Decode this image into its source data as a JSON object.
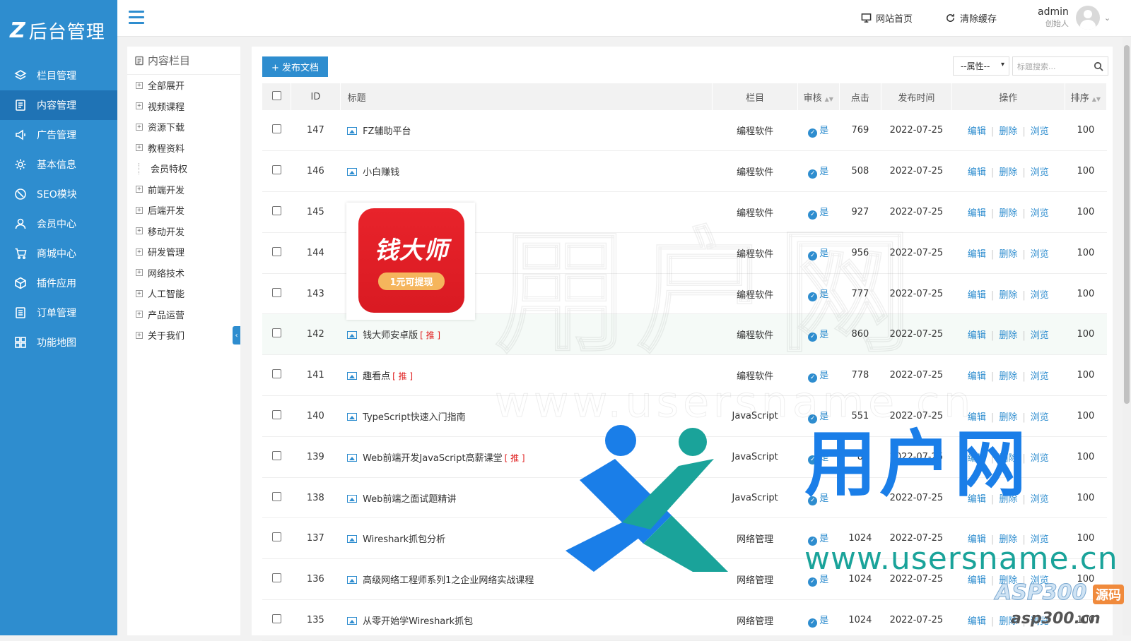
{
  "app": {
    "logo_mark": "Z",
    "logo_text": "后台管理"
  },
  "sidebar": {
    "items": [
      {
        "label": "栏目管理",
        "icon": "layers-icon",
        "active": false
      },
      {
        "label": "内容管理",
        "icon": "document-icon",
        "active": true
      },
      {
        "label": "广告管理",
        "icon": "megaphone-icon",
        "active": false
      },
      {
        "label": "基本信息",
        "icon": "gear-icon",
        "active": false
      },
      {
        "label": "SEO模块",
        "icon": "seo-icon",
        "active": false
      },
      {
        "label": "会员中心",
        "icon": "user-icon",
        "active": false
      },
      {
        "label": "商城中心",
        "icon": "cart-icon",
        "active": false
      },
      {
        "label": "插件应用",
        "icon": "cube-icon",
        "active": false
      },
      {
        "label": "订单管理",
        "icon": "order-icon",
        "active": false
      },
      {
        "label": "功能地图",
        "icon": "grid-icon",
        "active": false
      }
    ]
  },
  "header": {
    "site_home": "网站首页",
    "clear_cache": "清除缓存",
    "username": "admin",
    "role": "创始人"
  },
  "tree": {
    "title": "内容栏目",
    "items": [
      {
        "label": "全部展开",
        "expandable": true
      },
      {
        "label": "视频课程",
        "expandable": true
      },
      {
        "label": "资源下载",
        "expandable": true
      },
      {
        "label": "教程资料",
        "expandable": true
      },
      {
        "label": "会员特权",
        "expandable": false
      },
      {
        "label": "前端开发",
        "expandable": true
      },
      {
        "label": "后端开发",
        "expandable": true
      },
      {
        "label": "移动开发",
        "expandable": true
      },
      {
        "label": "研发管理",
        "expandable": true
      },
      {
        "label": "网络技术",
        "expandable": true
      },
      {
        "label": "人工智能",
        "expandable": true
      },
      {
        "label": "产品运营",
        "expandable": true
      },
      {
        "label": "关于我们",
        "expandable": true
      }
    ]
  },
  "toolbar": {
    "publish_label": "+ 发布文档",
    "attr_select": "--属性--",
    "search_placeholder": "标题搜索..."
  },
  "table": {
    "headers": {
      "id": "ID",
      "title": "标题",
      "column": "栏目",
      "audit": "审核",
      "clicks": "点击",
      "time": "发布时间",
      "ops": "操作",
      "sort": "排序"
    },
    "actions": {
      "edit": "编辑",
      "delete": "删除",
      "view": "浏览"
    },
    "rec_tag": "[ 推 ]",
    "rows": [
      {
        "id": "147",
        "title": "FZ辅助平台",
        "rec": false,
        "column": "编程软件",
        "audit": "是",
        "clicks": "769",
        "time": "2022-07-25",
        "sort": "100"
      },
      {
        "id": "146",
        "title": "小白赚钱",
        "rec": false,
        "column": "编程软件",
        "audit": "是",
        "clicks": "508",
        "time": "2022-07-25",
        "sort": "100"
      },
      {
        "id": "145",
        "title": "",
        "rec": false,
        "column": "编程软件",
        "audit": "是",
        "clicks": "927",
        "time": "2022-07-25",
        "sort": "100"
      },
      {
        "id": "144",
        "title": "",
        "rec": false,
        "column": "编程软件",
        "audit": "是",
        "clicks": "956",
        "time": "2022-07-25",
        "sort": "100"
      },
      {
        "id": "143",
        "title": "",
        "rec": false,
        "column": "编程软件",
        "audit": "是",
        "clicks": "777",
        "time": "2022-07-25",
        "sort": "100"
      },
      {
        "id": "142",
        "title": "钱大师安卓版",
        "rec": true,
        "column": "编程软件",
        "audit": "是",
        "clicks": "860",
        "time": "2022-07-25",
        "sort": "100",
        "highlight": true
      },
      {
        "id": "141",
        "title": "趣看点",
        "rec": true,
        "column": "编程软件",
        "audit": "是",
        "clicks": "778",
        "time": "2022-07-25",
        "sort": "100"
      },
      {
        "id": "140",
        "title": "TypeScript快速入门指南",
        "rec": false,
        "column": "JavaScript",
        "audit": "是",
        "clicks": "551",
        "time": "2022-07-25",
        "sort": "100"
      },
      {
        "id": "139",
        "title": "Web前端开发JavaScript高薪课堂",
        "rec": true,
        "column": "JavaScript",
        "audit": "是",
        "clicks": "8",
        "time": "2022-07-25",
        "sort": "100"
      },
      {
        "id": "138",
        "title": "Web前端之面试题精讲",
        "rec": false,
        "column": "JavaScript",
        "audit": "是",
        "clicks": "",
        "time": "2022-07-25",
        "sort": "100"
      },
      {
        "id": "137",
        "title": "Wireshark抓包分析",
        "rec": false,
        "column": "网络管理",
        "audit": "是",
        "clicks": "1024",
        "time": "2022-07-25",
        "sort": "100"
      },
      {
        "id": "136",
        "title": "高级网络工程师系列1之企业网络实战课程",
        "rec": false,
        "column": "网络管理",
        "audit": "是",
        "clicks": "1024",
        "time": "2022-07-25",
        "sort": "100"
      },
      {
        "id": "135",
        "title": "从零开始学Wireshark抓包",
        "rec": false,
        "column": "网络管理",
        "audit": "是",
        "clicks": "1024",
        "time": "2022-07-25",
        "sort": "100"
      }
    ]
  },
  "promo": {
    "title": "钱大师",
    "subtitle": "1元可提现"
  },
  "watermark": {
    "brand": "用户网",
    "url": "www.usersname.cn",
    "asp": "ASP300",
    "asp_tag": "源码",
    "asp_url": "asp300.cn"
  },
  "colors": {
    "primary": "#2e8dcf",
    "sidebar_active": "#1f73b5",
    "rec": "#e02020"
  }
}
